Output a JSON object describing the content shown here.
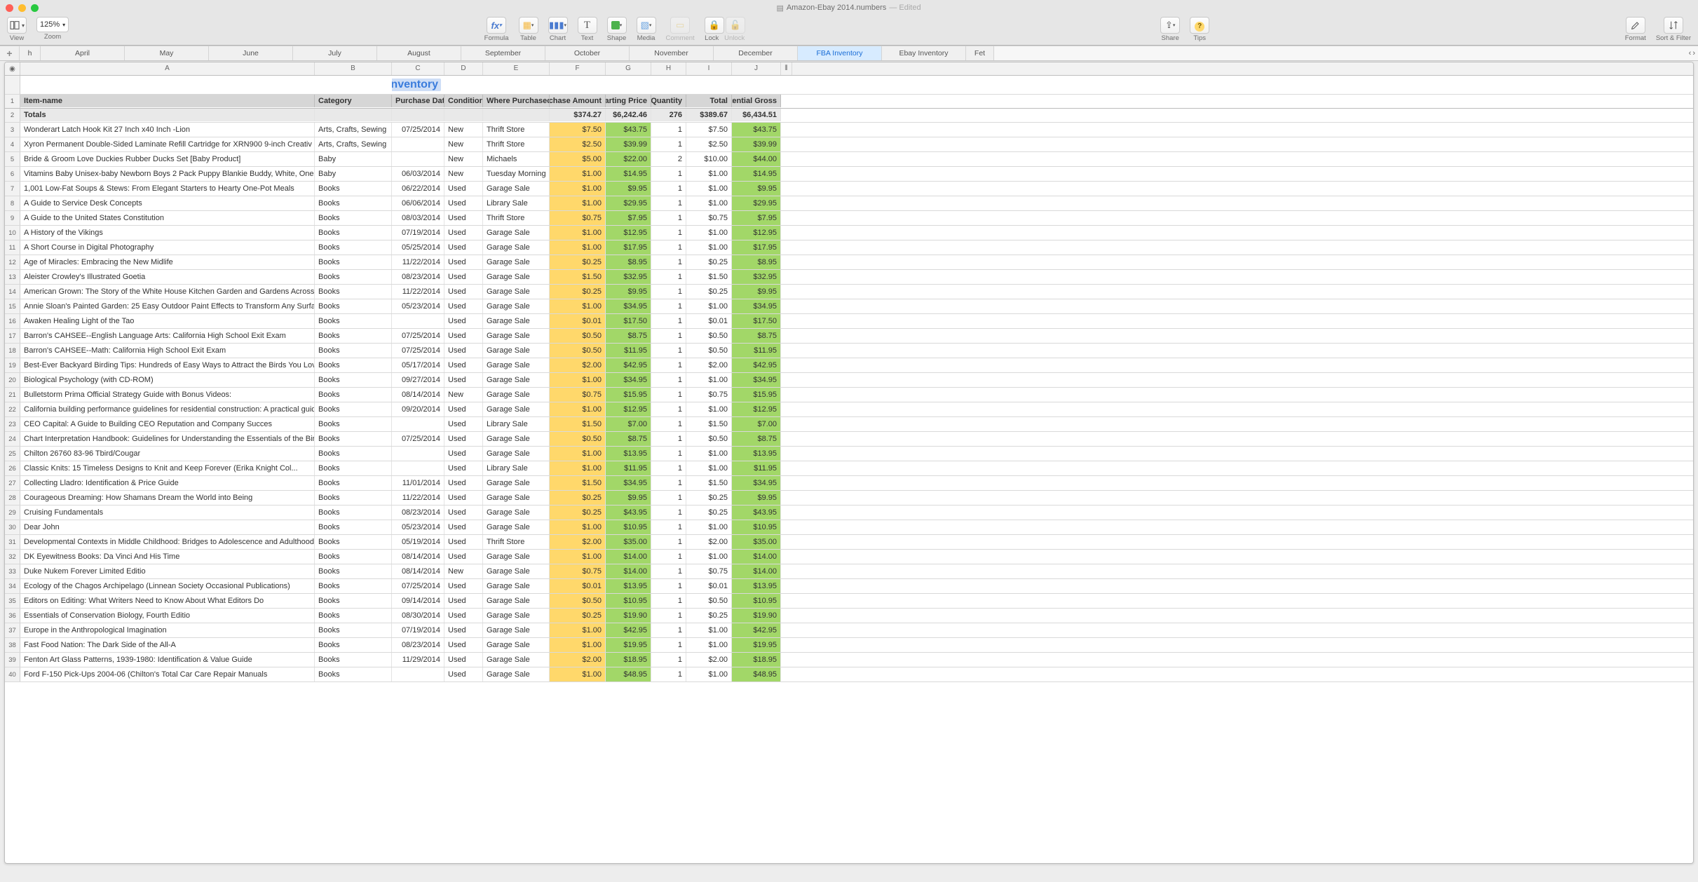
{
  "window": {
    "title": "Amazon-Ebay 2014.numbers",
    "edited": "— Edited"
  },
  "toolbar": {
    "view": "View",
    "zoom_label": "Zoom",
    "zoom_value": "125%",
    "formula": "Formula",
    "table": "Table",
    "chart": "Chart",
    "text": "Text",
    "shape": "Shape",
    "media": "Media",
    "comment": "Comment",
    "lock": "Lock",
    "unlock": "Unlock",
    "share": "Share",
    "tips": "Tips",
    "format": "Format",
    "sort_filter": "Sort & Filter"
  },
  "sheets": {
    "items": [
      "h",
      "April",
      "May",
      "June",
      "July",
      "August",
      "September",
      "October",
      "November",
      "December",
      "FBA Inventory",
      "Ebay Inventory",
      "Fet"
    ],
    "active_index": 10
  },
  "table": {
    "title": "FBA Inventory",
    "col_letters": [
      "A",
      "B",
      "C",
      "D",
      "E",
      "F",
      "G",
      "H",
      "I",
      "J"
    ],
    "headers": [
      "Item-name",
      "Category",
      "Purchase Date",
      "Condition",
      "Where Purchased",
      "Purchase Amount",
      "Starting Price",
      "Quantity",
      "Total",
      "Potential Gross"
    ],
    "totals": {
      "label": "Totals",
      "amount": "$374.27",
      "starting": "$6,242.46",
      "qty": "276",
      "total": "$389.67",
      "gross": "$6,434.51"
    },
    "rows": [
      {
        "n": 3,
        "a": "Wonderart Latch Hook Kit 27 Inch x40 Inch -Lion",
        "b": "Arts, Crafts, Sewing",
        "c": "07/25/2014",
        "d": "New",
        "e": "Thrift Store",
        "f": "$7.50",
        "g": "$43.75",
        "h": "1",
        "i": "$7.50",
        "j": "$43.75"
      },
      {
        "n": 4,
        "a": "Xyron Permanent Double-Sided Laminate Refill Cartridge for XRN900 9-inch Creativ",
        "b": "Arts, Crafts, Sewing",
        "c": "",
        "d": "New",
        "e": "Thrift Store",
        "f": "$2.50",
        "g": "$39.99",
        "h": "1",
        "i": "$2.50",
        "j": "$39.99"
      },
      {
        "n": 5,
        "a": "Bride & Groom Love Duckies Rubber Ducks Set [Baby Product]",
        "b": "Baby",
        "c": "",
        "d": "New",
        "e": "Michaels",
        "f": "$5.00",
        "g": "$22.00",
        "h": "2",
        "i": "$10.00",
        "j": "$44.00"
      },
      {
        "n": 6,
        "a": "Vitamins Baby Unisex-baby Newborn Boys 2 Pack Puppy Blankie Buddy, White, One Siz",
        "b": "Baby",
        "c": "06/03/2014",
        "d": "New",
        "e": "Tuesday Morning",
        "f": "$1.00",
        "g": "$14.95",
        "h": "1",
        "i": "$1.00",
        "j": "$14.95"
      },
      {
        "n": 7,
        "a": "1,001 Low-Fat Soups & Stews: From Elegant Starters to Hearty One-Pot Meals",
        "b": "Books",
        "c": "06/22/2014",
        "d": "Used",
        "e": "Garage Sale",
        "f": "$1.00",
        "g": "$9.95",
        "h": "1",
        "i": "$1.00",
        "j": "$9.95"
      },
      {
        "n": 8,
        "a": "A Guide to Service Desk Concepts",
        "b": "Books",
        "c": "06/06/2014",
        "d": "Used",
        "e": "Library Sale",
        "f": "$1.00",
        "g": "$29.95",
        "h": "1",
        "i": "$1.00",
        "j": "$29.95"
      },
      {
        "n": 9,
        "a": "A Guide to the United States Constitution",
        "b": "Books",
        "c": "08/03/2014",
        "d": "Used",
        "e": "Thrift Store",
        "f": "$0.75",
        "g": "$7.95",
        "h": "1",
        "i": "$0.75",
        "j": "$7.95"
      },
      {
        "n": 10,
        "a": "A History of the Vikings",
        "b": "Books",
        "c": "07/19/2014",
        "d": "Used",
        "e": "Garage Sale",
        "f": "$1.00",
        "g": "$12.95",
        "h": "1",
        "i": "$1.00",
        "j": "$12.95"
      },
      {
        "n": 11,
        "a": "A Short Course in Digital Photography",
        "b": "Books",
        "c": "05/25/2014",
        "d": "Used",
        "e": "Garage Sale",
        "f": "$1.00",
        "g": "$17.95",
        "h": "1",
        "i": "$1.00",
        "j": "$17.95"
      },
      {
        "n": 12,
        "a": "Age of Miracles: Embracing the New Midlife",
        "b": "Books",
        "c": "11/22/2014",
        "d": "Used",
        "e": "Garage Sale",
        "f": "$0.25",
        "g": "$8.95",
        "h": "1",
        "i": "$0.25",
        "j": "$8.95"
      },
      {
        "n": 13,
        "a": "Aleister Crowley's Illustrated Goetia",
        "b": "Books",
        "c": "08/23/2014",
        "d": "Used",
        "e": "Garage Sale",
        "f": "$1.50",
        "g": "$32.95",
        "h": "1",
        "i": "$1.50",
        "j": "$32.95"
      },
      {
        "n": 14,
        "a": "American Grown: The Story of the White House Kitchen Garden and Gardens Across America",
        "b": "Books",
        "c": "11/22/2014",
        "d": "Used",
        "e": "Garage Sale",
        "f": "$0.25",
        "g": "$9.95",
        "h": "1",
        "i": "$0.25",
        "j": "$9.95"
      },
      {
        "n": 15,
        "a": "Annie Sloan's Painted Garden: 25 Easy Outdoor Paint Effects to Transform Any Surface",
        "b": "Books",
        "c": "05/23/2014",
        "d": "Used",
        "e": "Garage Sale",
        "f": "$1.00",
        "g": "$34.95",
        "h": "1",
        "i": "$1.00",
        "j": "$34.95"
      },
      {
        "n": 16,
        "a": "Awaken Healing Light of the Tao",
        "b": "Books",
        "c": "",
        "d": "Used",
        "e": "Garage Sale",
        "f": "$0.01",
        "g": "$17.50",
        "h": "1",
        "i": "$0.01",
        "j": "$17.50"
      },
      {
        "n": 17,
        "a": "Barron's CAHSEE--English Language Arts: California High School Exit Exam",
        "b": "Books",
        "c": "07/25/2014",
        "d": "Used",
        "e": "Garage Sale",
        "f": "$0.50",
        "g": "$8.75",
        "h": "1",
        "i": "$0.50",
        "j": "$8.75"
      },
      {
        "n": 18,
        "a": "Barron's CAHSEE--Math: California High School Exit Exam",
        "b": "Books",
        "c": "07/25/2014",
        "d": "Used",
        "e": "Garage Sale",
        "f": "$0.50",
        "g": "$11.95",
        "h": "1",
        "i": "$0.50",
        "j": "$11.95"
      },
      {
        "n": 19,
        "a": "Best-Ever Backyard Birding Tips: Hundreds of Easy Ways to Attract the Birds You Love to Watch",
        "b": "Books",
        "c": "05/17/2014",
        "d": "Used",
        "e": "Garage Sale",
        "f": "$2.00",
        "g": "$42.95",
        "h": "1",
        "i": "$2.00",
        "j": "$42.95"
      },
      {
        "n": 20,
        "a": "Biological Psychology (with CD-ROM)",
        "b": "Books",
        "c": "09/27/2014",
        "d": "Used",
        "e": "Garage Sale",
        "f": "$1.00",
        "g": "$34.95",
        "h": "1",
        "i": "$1.00",
        "j": "$34.95"
      },
      {
        "n": 21,
        "a": "Bulletstorm Prima Official Strategy Guide with Bonus Videos:",
        "b": "Books",
        "c": "08/14/2014",
        "d": "New",
        "e": "Garage Sale",
        "f": "$0.75",
        "g": "$15.95",
        "h": "1",
        "i": "$0.75",
        "j": "$15.95"
      },
      {
        "n": 22,
        "a": "California building performance guidelines for residential construction: A practical guide for owners of new homes : constr",
        "b": "Books",
        "c": "09/20/2014",
        "d": "Used",
        "e": "Garage Sale",
        "f": "$1.00",
        "g": "$12.95",
        "h": "1",
        "i": "$1.00",
        "j": "$12.95"
      },
      {
        "n": 23,
        "a": "CEO Capital: A Guide to Building CEO Reputation and Company Succes",
        "b": "Books",
        "c": "",
        "d": "Used",
        "e": "Library Sale",
        "f": "$1.50",
        "g": "$7.00",
        "h": "1",
        "i": "$1.50",
        "j": "$7.00"
      },
      {
        "n": 24,
        "a": "Chart Interpretation Handbook: Guidelines for Understanding the Essentials of the Birth Chart",
        "b": "Books",
        "c": "07/25/2014",
        "d": "Used",
        "e": "Garage Sale",
        "f": "$0.50",
        "g": "$8.75",
        "h": "1",
        "i": "$0.50",
        "j": "$8.75"
      },
      {
        "n": 25,
        "a": "Chilton 26760 83-96 Tbird/Cougar",
        "b": "Books",
        "c": "",
        "d": "Used",
        "e": "Garage Sale",
        "f": "$1.00",
        "g": "$13.95",
        "h": "1",
        "i": "$1.00",
        "j": "$13.95"
      },
      {
        "n": 26,
        "a": "Classic Knits: 15 Timeless Designs to Knit and Keep Forever (Erika Knight Col...",
        "b": "Books",
        "c": "",
        "d": "Used",
        "e": "Library Sale",
        "f": "$1.00",
        "g": "$11.95",
        "h": "1",
        "i": "$1.00",
        "j": "$11.95"
      },
      {
        "n": 27,
        "a": "Collecting Lladro: Identification & Price Guide",
        "b": "Books",
        "c": "11/01/2014",
        "d": "Used",
        "e": "Garage Sale",
        "f": "$1.50",
        "g": "$34.95",
        "h": "1",
        "i": "$1.50",
        "j": "$34.95"
      },
      {
        "n": 28,
        "a": "Courageous Dreaming: How Shamans Dream the World into Being",
        "b": "Books",
        "c": "11/22/2014",
        "d": "Used",
        "e": "Garage Sale",
        "f": "$0.25",
        "g": "$9.95",
        "h": "1",
        "i": "$0.25",
        "j": "$9.95"
      },
      {
        "n": 29,
        "a": "Cruising Fundamentals",
        "b": "Books",
        "c": "08/23/2014",
        "d": "Used",
        "e": "Garage Sale",
        "f": "$0.25",
        "g": "$43.95",
        "h": "1",
        "i": "$0.25",
        "j": "$43.95"
      },
      {
        "n": 30,
        "a": "Dear John",
        "b": "Books",
        "c": "05/23/2014",
        "d": "Used",
        "e": "Garage Sale",
        "f": "$1.00",
        "g": "$10.95",
        "h": "1",
        "i": "$1.00",
        "j": "$10.95"
      },
      {
        "n": 31,
        "a": "Developmental Contexts in Middle Childhood: Bridges to Adolescence and Adulthood",
        "b": "Books",
        "c": "05/19/2014",
        "d": "Used",
        "e": "Thrift Store",
        "f": "$2.00",
        "g": "$35.00",
        "h": "1",
        "i": "$2.00",
        "j": "$35.00"
      },
      {
        "n": 32,
        "a": "DK Eyewitness Books: Da Vinci And His Time",
        "b": "Books",
        "c": "08/14/2014",
        "d": "Used",
        "e": "Garage Sale",
        "f": "$1.00",
        "g": "$14.00",
        "h": "1",
        "i": "$1.00",
        "j": "$14.00"
      },
      {
        "n": 33,
        "a": "Duke Nukem Forever Limited Editio",
        "b": "Books",
        "c": "08/14/2014",
        "d": "New",
        "e": "Garage Sale",
        "f": "$0.75",
        "g": "$14.00",
        "h": "1",
        "i": "$0.75",
        "j": "$14.00"
      },
      {
        "n": 34,
        "a": "Ecology of the Chagos Archipelago (Linnean Society Occasional Publications)",
        "b": "Books",
        "c": "07/25/2014",
        "d": "Used",
        "e": "Garage Sale",
        "f": "$0.01",
        "g": "$13.95",
        "h": "1",
        "i": "$0.01",
        "j": "$13.95"
      },
      {
        "n": 35,
        "a": "Editors on Editing: What Writers Need to Know About What Editors Do",
        "b": "Books",
        "c": "09/14/2014",
        "d": "Used",
        "e": "Garage Sale",
        "f": "$0.50",
        "g": "$10.95",
        "h": "1",
        "i": "$0.50",
        "j": "$10.95"
      },
      {
        "n": 36,
        "a": "Essentials of Conservation Biology, Fourth Editio",
        "b": "Books",
        "c": "08/30/2014",
        "d": "Used",
        "e": "Garage Sale",
        "f": "$0.25",
        "g": "$19.90",
        "h": "1",
        "i": "$0.25",
        "j": "$19.90"
      },
      {
        "n": 37,
        "a": "Europe in the Anthropological Imagination",
        "b": "Books",
        "c": "07/19/2014",
        "d": "Used",
        "e": "Garage Sale",
        "f": "$1.00",
        "g": "$42.95",
        "h": "1",
        "i": "$1.00",
        "j": "$42.95"
      },
      {
        "n": 38,
        "a": "Fast Food Nation: The Dark Side of the All-A",
        "b": "Books",
        "c": "08/23/2014",
        "d": "Used",
        "e": "Garage Sale",
        "f": "$1.00",
        "g": "$19.95",
        "h": "1",
        "i": "$1.00",
        "j": "$19.95"
      },
      {
        "n": 39,
        "a": "Fenton Art Glass Patterns, 1939-1980: Identification & Value Guide",
        "b": "Books",
        "c": "11/29/2014",
        "d": "Used",
        "e": "Garage Sale",
        "f": "$2.00",
        "g": "$18.95",
        "h": "1",
        "i": "$2.00",
        "j": "$18.95"
      },
      {
        "n": 40,
        "a": "Ford F-150 Pick-Ups 2004-06 (Chilton's Total Car Care Repair Manuals",
        "b": "Books",
        "c": "",
        "d": "Used",
        "e": "Garage Sale",
        "f": "$1.00",
        "g": "$48.95",
        "h": "1",
        "i": "$1.00",
        "j": "$48.95"
      }
    ]
  }
}
